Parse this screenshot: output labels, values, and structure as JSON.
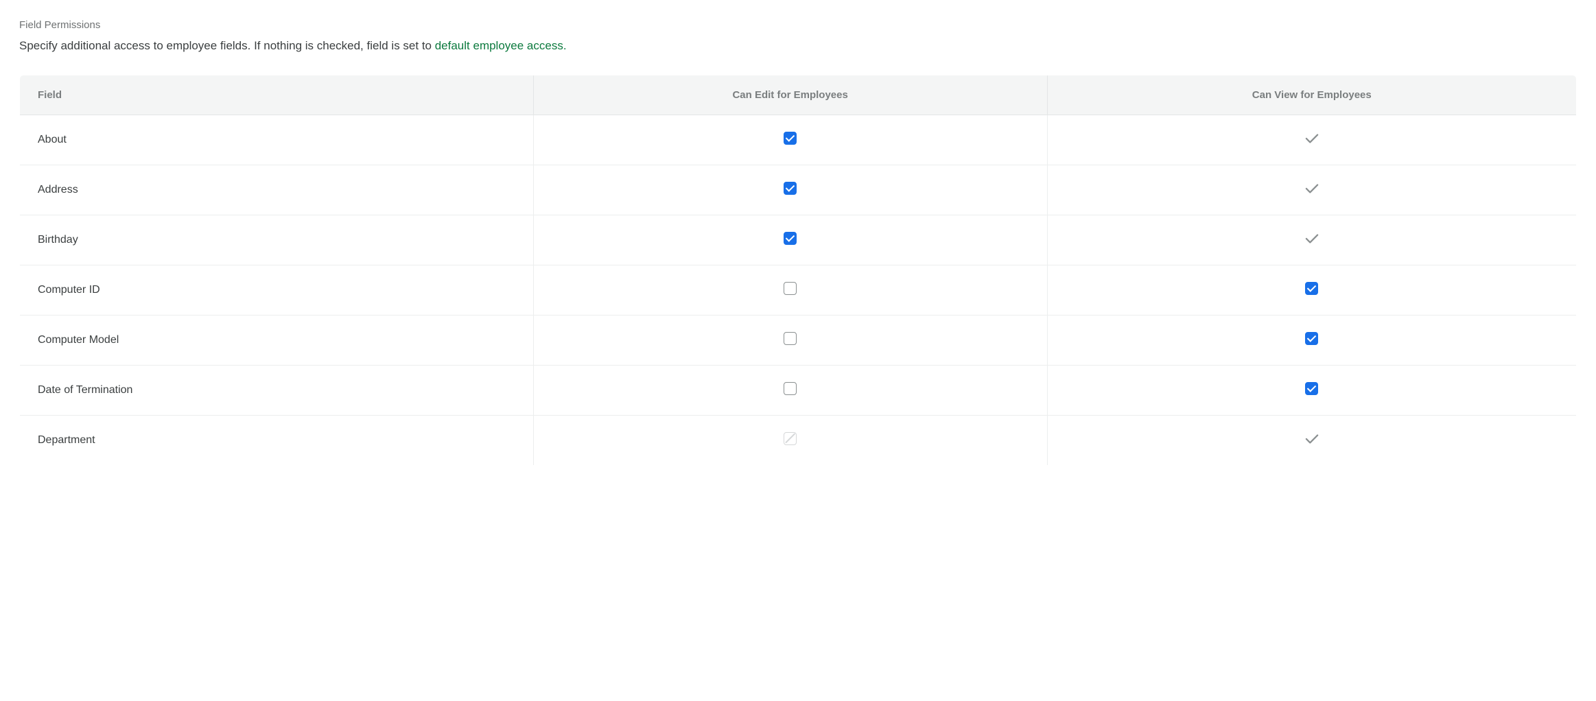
{
  "heading": "Field Permissions",
  "description_prefix": "Specify additional access to employee fields. If nothing is checked, field is set to ",
  "description_link": "default employee access.",
  "columns": {
    "field": "Field",
    "edit": "Can Edit for Employees",
    "view": "Can View for Employees"
  },
  "rows": [
    {
      "field": "About",
      "edit": "checked",
      "view": "locked"
    },
    {
      "field": "Address",
      "edit": "checked",
      "view": "locked"
    },
    {
      "field": "Birthday",
      "edit": "checked",
      "view": "locked"
    },
    {
      "field": "Computer ID",
      "edit": "unchecked",
      "view": "checked"
    },
    {
      "field": "Computer Model",
      "edit": "unchecked",
      "view": "checked"
    },
    {
      "field": "Date of Termination",
      "edit": "unchecked",
      "view": "checked"
    },
    {
      "field": "Department",
      "edit": "disabled",
      "view": "locked"
    }
  ]
}
